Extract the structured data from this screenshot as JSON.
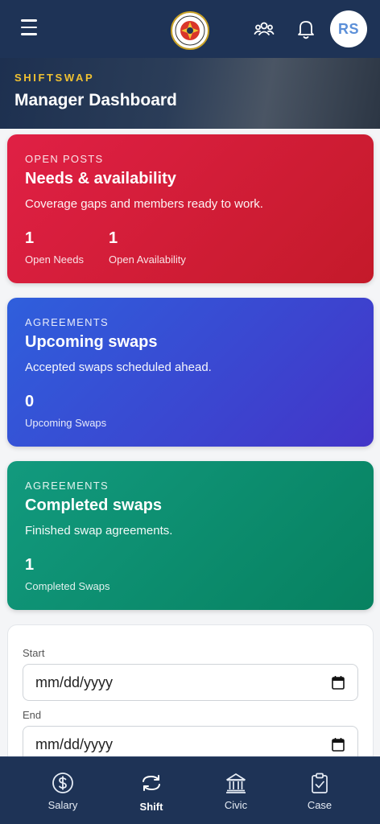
{
  "header": {
    "menu_icon": "hamburger-menu-icon",
    "logo_icon": "fire-department-badge-icon",
    "team_icon": "people-group-icon",
    "notifications_icon": "bell-icon",
    "avatar_initials": "RS"
  },
  "hero": {
    "kicker": "SHIFTSWAP",
    "title": "Manager Dashboard"
  },
  "cards": {
    "open_posts": {
      "kicker": "OPEN POSTS",
      "title": "Needs & availability",
      "description": "Coverage gaps and members ready to work.",
      "stats": [
        {
          "value": "1",
          "label": "Open Needs"
        },
        {
          "value": "1",
          "label": "Open Availability"
        }
      ],
      "color": "#d81f3a"
    },
    "upcoming": {
      "kicker": "AGREEMENTS",
      "title": "Upcoming swaps",
      "description": "Accepted swaps scheduled ahead.",
      "stats": [
        {
          "value": "0",
          "label": "Upcoming Swaps"
        }
      ],
      "color": "#3a4ad4"
    },
    "completed": {
      "kicker": "AGREEMENTS",
      "title": "Completed swaps",
      "description": "Finished swap agreements.",
      "stats": [
        {
          "value": "1",
          "label": "Completed Swaps"
        }
      ],
      "color": "#0e8d6e"
    }
  },
  "filters": {
    "start_label": "Start",
    "start_value": "mm/dd/yyyy",
    "end_label": "End",
    "end_value": "mm/dd/yyyy",
    "calendar_icon": "calendar-icon"
  },
  "bottom_nav": {
    "items": [
      {
        "label": "Salary",
        "icon": "dollar-circle-icon",
        "active": false
      },
      {
        "label": "Shift",
        "icon": "swap-arrows-icon",
        "active": true
      },
      {
        "label": "Civic",
        "icon": "government-building-icon",
        "active": false
      },
      {
        "label": "Case",
        "icon": "clipboard-check-icon",
        "active": false
      }
    ]
  },
  "colors": {
    "navy": "#1e3356",
    "accent_yellow": "#f1c232",
    "avatar_text": "#5b8fd8"
  }
}
